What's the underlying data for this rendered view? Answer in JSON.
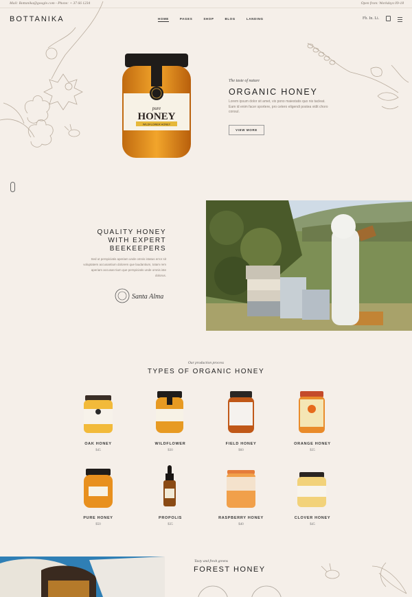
{
  "topbar": {
    "contact": "Mail: Bottanika@google.com - Phone: + 37 66 1234",
    "hours": "Open from: Workdays 09-18"
  },
  "header": {
    "logo": "BOTTANIKA",
    "nav": [
      "HOME",
      "PAGES",
      "SHOP",
      "BLOG",
      "LANDING"
    ],
    "social": "Fb. In. Li."
  },
  "hero": {
    "subtitle": "The taste of nature",
    "title": "ORGANIC HONEY",
    "text": "Lorem ipsum dolor sit amet, vix pono maiestatis quo nis tacleat. Eam id enim facer sportere, pro cetero eligendi postea vidit choro consul.",
    "button": "VIEW MORE",
    "jar_label_top": "pure",
    "jar_label_main": "HONEY",
    "jar_label_sub": "WILDFLOWER HONEY"
  },
  "quality": {
    "title_lines": [
      "QUALITY HONEY",
      "WITH EXPERT",
      "BEEKEEPERS"
    ],
    "text": "Sed ut perspiciatis aperiam unde omnis istatus error sit voluptatem accusantium dolorem que laudantium, totam rem aperiam accusan tium que perspiciatis unde omnis iste dolorus.",
    "signature": "Santa Alma"
  },
  "products": {
    "subtitle": "Our production process",
    "title": "TYPES OF ORGANIC HONEY",
    "items": [
      {
        "name": "OAK HONEY",
        "price": "$45"
      },
      {
        "name": "WILDFLOWER",
        "price": "$30"
      },
      {
        "name": "FIELD HONEY",
        "price": "$60"
      },
      {
        "name": "ORANGE HONEY",
        "price": "$35"
      },
      {
        "name": "PURE HONEY",
        "price": "$50"
      },
      {
        "name": "PROPOLIS",
        "price": "$35"
      },
      {
        "name": "RASPBERRY HONEY",
        "price": "$40"
      },
      {
        "name": "CLOVER HONEY",
        "price": "$45"
      }
    ]
  },
  "forest": {
    "subtitle": "Tasty and fresh greens",
    "title": "FOREST HONEY"
  },
  "colors": {
    "background": "#f5efe9",
    "honey": "#e39a1f",
    "line_art": "#b8ab9c"
  }
}
